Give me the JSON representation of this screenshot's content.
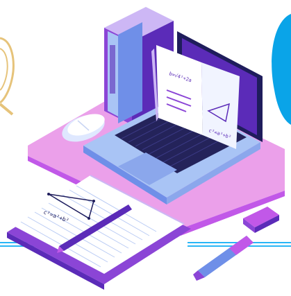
{
  "scene": {
    "palette": {
      "purple_dark": "#5b2bb8",
      "purple": "#8b45d6",
      "magenta": "#c158e8",
      "lavender": "#cdb7f5",
      "pink_pad": "#e88fe6",
      "blue_light": "#a9c4f5",
      "blue_mid": "#6f8fe8",
      "navy": "#1f1d5c",
      "keyboard": "#24235a",
      "cyan_line": "#29b6f6",
      "cyan_blob": "#0aa4e8",
      "gold": "#e6c37a",
      "white": "#ffffff"
    },
    "icons": [
      "books-icon",
      "laptop-icon",
      "open-book-icon",
      "notebook-icon",
      "pen-icon",
      "eraser-icon",
      "mouse-icon",
      "magnifier-icon"
    ],
    "screen_formula": "b=√4²+2a",
    "page_formula": "c²=a²+b²",
    "notebook_formula": "c²=a²+b²"
  }
}
